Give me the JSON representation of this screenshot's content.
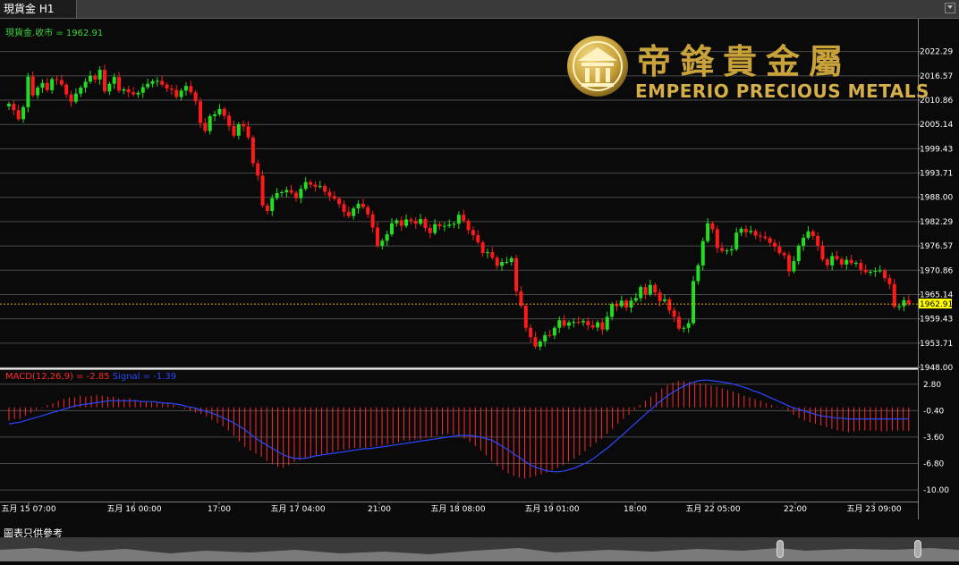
{
  "tab": {
    "title": "現貨金 H1"
  },
  "legend": {
    "main": "現貨金.收市 = 1962.91",
    "macd": "MACD(12,26,9) = -2.85",
    "signal": "Signal = -1.39"
  },
  "logo": {
    "chinese": "帝鋒貴金屬",
    "english": "EMPERIO PRECIOUS METALS"
  },
  "disclaimer": "圖表只供參考",
  "colors": {
    "up": "#22dd22",
    "down": "#ff1a1a",
    "macd_hist": "#ff2a2a",
    "signal": "#2b47ff",
    "current_price_line": "#e0a020",
    "current_price_badge": "#ffff00"
  },
  "chart_data": {
    "type": "candlestick",
    "timeframe": "H1",
    "price_axis": [
      "2022.29",
      "2016.57",
      "2010.86",
      "2005.14",
      "1999.43",
      "1993.71",
      "1988.00",
      "1982.29",
      "1976.57",
      "1970.86",
      "1965.14",
      "1959.43",
      "1953.71",
      "1948.00"
    ],
    "price_range": [
      1948.0,
      2026.0
    ],
    "current_price": "1962.91",
    "macd_axis": [
      "2.80",
      "-0.40",
      "-3.60",
      "-6.80",
      "-10.00"
    ],
    "macd_range": [
      -11.4,
      4.4
    ],
    "time_axis": [
      "五月 15 07:00",
      "五月 16 00:00",
      "17:00",
      "五月 17 04:00",
      "21:00",
      "五月 18 08:00",
      "五月 19 01:00",
      "18:00",
      "五月 22 05:00",
      "22:00",
      "五月 23 09:00"
    ],
    "ohlc_close": [
      2010.0,
      2008.5,
      2006.4,
      2009.2,
      2016.4,
      2012.0,
      2013.8,
      2014.9,
      2013.2,
      2015.8,
      2015.6,
      2014.5,
      2012.2,
      2010.5,
      2012.4,
      2013.8,
      2015.2,
      2016.6,
      2015.7,
      2018.0,
      2012.9,
      2014.7,
      2016.3,
      2013.1,
      2013.4,
      2012.7,
      2012.2,
      2012.6,
      2013.9,
      2014.7,
      2015.3,
      2015.4,
      2014.5,
      2013.6,
      2013.3,
      2011.6,
      2013.1,
      2014.2,
      2012.7,
      2010.6,
      2005.5,
      2003.6,
      2007.1,
      2007.5,
      2008.8,
      2007.2,
      2004.8,
      2002.5,
      2005.2,
      2004.7,
      2002.1,
      1996.0,
      1993.1,
      1986.1,
      1984.8,
      1987.8,
      1989.0,
      1989.2,
      1989.7,
      1989.1,
      1987.8,
      1990.0,
      1991.6,
      1991.0,
      1990.5,
      1990.7,
      1989.3,
      1988.3,
      1987.7,
      1986.4,
      1984.6,
      1983.6,
      1985.4,
      1986.5,
      1985.7,
      1984.0,
      1980.9,
      1976.6,
      1977.8,
      1979.3,
      1981.9,
      1982.6,
      1981.3,
      1982.8,
      1982.5,
      1981.8,
      1982.9,
      1980.8,
      1979.6,
      1981.7,
      1981.2,
      1981.3,
      1981.6,
      1981.8,
      1983.9,
      1982.5,
      1980.3,
      1979.1,
      1977.4,
      1974.9,
      1975.1,
      1973.8,
      1971.9,
      1972.8,
      1972.8,
      1973.7,
      1965.9,
      1962.5,
      1957.3,
      1955.1,
      1952.9,
      1954.1,
      1955.6,
      1955.5,
      1957.3,
      1959.1,
      1957.8,
      1958.6,
      1958.7,
      1958.6,
      1958.9,
      1957.9,
      1957.4,
      1958.6,
      1956.9,
      1959.9,
      1962.9,
      1962.4,
      1963.7,
      1962.1,
      1963.7,
      1964.3,
      1966.9,
      1965.2,
      1967.4,
      1965.6,
      1963.6,
      1964.0,
      1961.4,
      1959.9,
      1957.1,
      1957.3,
      1958.4,
      1968.3,
      1972.0,
      1977.7,
      1981.9,
      1980.5,
      1976.1,
      1975.4,
      1975.5,
      1975.8,
      1979.7,
      1980.6,
      1979.8,
      1980.1,
      1979.0,
      1978.8,
      1978.4,
      1977.3,
      1976.4,
      1974.9,
      1974.4,
      1970.6,
      1973.0,
      1976.6,
      1978.5,
      1980.0,
      1978.9,
      1976.6,
      1973.4,
      1972.0,
      1974.2,
      1973.5,
      1972.2,
      1973.3,
      1972.5,
      1972.6,
      1971.0,
      1970.4,
      1970.5,
      1970.7,
      1970.8,
      1969.0,
      1967.6,
      1962.3,
      1962.4,
      1963.8,
      1962.9
    ],
    "macd_histogram": [
      -1.6,
      -1.4,
      -1.4,
      -1.0,
      -0.7,
      -0.3,
      -0.1,
      0.3,
      0.5,
      0.8,
      1.0,
      1.2,
      1.2,
      1.4,
      1.3,
      1.4,
      1.5,
      1.4,
      1.3,
      1.3,
      1.1,
      1.0,
      1.1,
      0.9,
      0.8,
      0.7,
      0.6,
      0.6,
      0.5,
      0.5,
      0.3,
      0.1,
      -0.2,
      -0.4,
      -0.6,
      -0.8,
      -1.1,
      -1.5,
      -1.9,
      -2.3,
      -2.8,
      -3.4,
      -4.1,
      -4.8,
      -5.2,
      -5.6,
      -6.0,
      -6.5,
      -6.9,
      -7.2,
      -7.3,
      -7.0,
      -6.6,
      -6.4,
      -6.2,
      -6.1,
      -5.9,
      -5.8,
      -5.6,
      -5.4,
      -5.2,
      -5.1,
      -5.0,
      -4.9,
      -4.9,
      -4.9,
      -4.8,
      -4.7,
      -4.6,
      -4.5,
      -4.4,
      -4.2,
      -4.0,
      -4.0,
      -3.9,
      -3.9,
      -3.7,
      -3.6,
      -3.4,
      -3.3,
      -3.2,
      -3.3,
      -3.5,
      -3.8,
      -4.2,
      -4.7,
      -5.2,
      -5.8,
      -6.5,
      -7.1,
      -7.6,
      -8.0,
      -8.3,
      -8.5,
      -8.6,
      -8.5,
      -8.3,
      -8.1,
      -7.9,
      -7.6,
      -7.3,
      -7.0,
      -6.6,
      -6.2,
      -5.8,
      -5.3,
      -4.8,
      -4.3,
      -3.8,
      -3.2,
      -2.6,
      -2.0,
      -1.4,
      -0.9,
      -0.3,
      0.3,
      0.8,
      1.3,
      1.8,
      2.3,
      2.7,
      3.0,
      3.2,
      3.2,
      3.1,
      3.0,
      2.9,
      2.8,
      2.6,
      2.5,
      2.3,
      2.1,
      1.9,
      1.7,
      1.4,
      1.2,
      1.0,
      0.8,
      0.5,
      0.3,
      0.1,
      -0.1,
      -0.5,
      -0.9,
      -1.3,
      -1.6,
      -1.8,
      -2.0,
      -2.2,
      -2.4,
      -2.6,
      -2.8,
      -2.9,
      -3.0,
      -2.9,
      -2.8,
      -2.8,
      -2.8,
      -2.8,
      -2.9,
      -2.9,
      -2.8,
      -2.8,
      -2.8,
      -2.85
    ],
    "signal_line": [
      -2.0,
      -1.9,
      -1.8,
      -1.6,
      -1.4,
      -1.2,
      -1.0,
      -0.8,
      -0.6,
      -0.4,
      -0.2,
      0.0,
      0.2,
      0.3,
      0.4,
      0.5,
      0.6,
      0.7,
      0.8,
      0.8,
      0.8,
      0.8,
      0.8,
      0.8,
      0.7,
      0.7,
      0.7,
      0.6,
      0.5,
      0.5,
      0.4,
      0.3,
      0.1,
      0.0,
      -0.2,
      -0.4,
      -0.6,
      -0.8,
      -1.1,
      -1.4,
      -1.7,
      -2.1,
      -2.5,
      -3.0,
      -3.5,
      -4.0,
      -4.4,
      -4.8,
      -5.2,
      -5.6,
      -5.9,
      -6.1,
      -6.2,
      -6.2,
      -6.1,
      -5.9,
      -5.8,
      -5.7,
      -5.6,
      -5.5,
      -5.4,
      -5.3,
      -5.2,
      -5.1,
      -5.0,
      -5.0,
      -4.9,
      -4.8,
      -4.7,
      -4.6,
      -4.5,
      -4.4,
      -4.3,
      -4.2,
      -4.1,
      -4.0,
      -3.9,
      -3.8,
      -3.7,
      -3.6,
      -3.5,
      -3.4,
      -3.4,
      -3.4,
      -3.5,
      -3.6,
      -3.8,
      -4.0,
      -4.4,
      -4.8,
      -5.2,
      -5.7,
      -6.1,
      -6.6,
      -7.0,
      -7.3,
      -7.5,
      -7.7,
      -7.8,
      -7.8,
      -7.7,
      -7.5,
      -7.3,
      -7.0,
      -6.7,
      -6.3,
      -5.8,
      -5.3,
      -4.8,
      -4.2,
      -3.6,
      -3.0,
      -2.4,
      -1.8,
      -1.2,
      -0.6,
      0.0,
      0.6,
      1.1,
      1.6,
      2.0,
      2.4,
      2.7,
      3.0,
      3.2,
      3.3,
      3.3,
      3.2,
      3.1,
      3.0,
      2.9,
      2.7,
      2.5,
      2.3,
      2.0,
      1.8,
      1.5,
      1.2,
      0.9,
      0.6,
      0.3,
      0.0,
      -0.2,
      -0.4,
      -0.6,
      -0.8,
      -1.0,
      -1.1,
      -1.2,
      -1.3,
      -1.3,
      -1.4,
      -1.4,
      -1.4,
      -1.4,
      -1.4,
      -1.4,
      -1.4,
      -1.4,
      -1.4,
      -1.4,
      -1.4,
      -1.39
    ]
  }
}
